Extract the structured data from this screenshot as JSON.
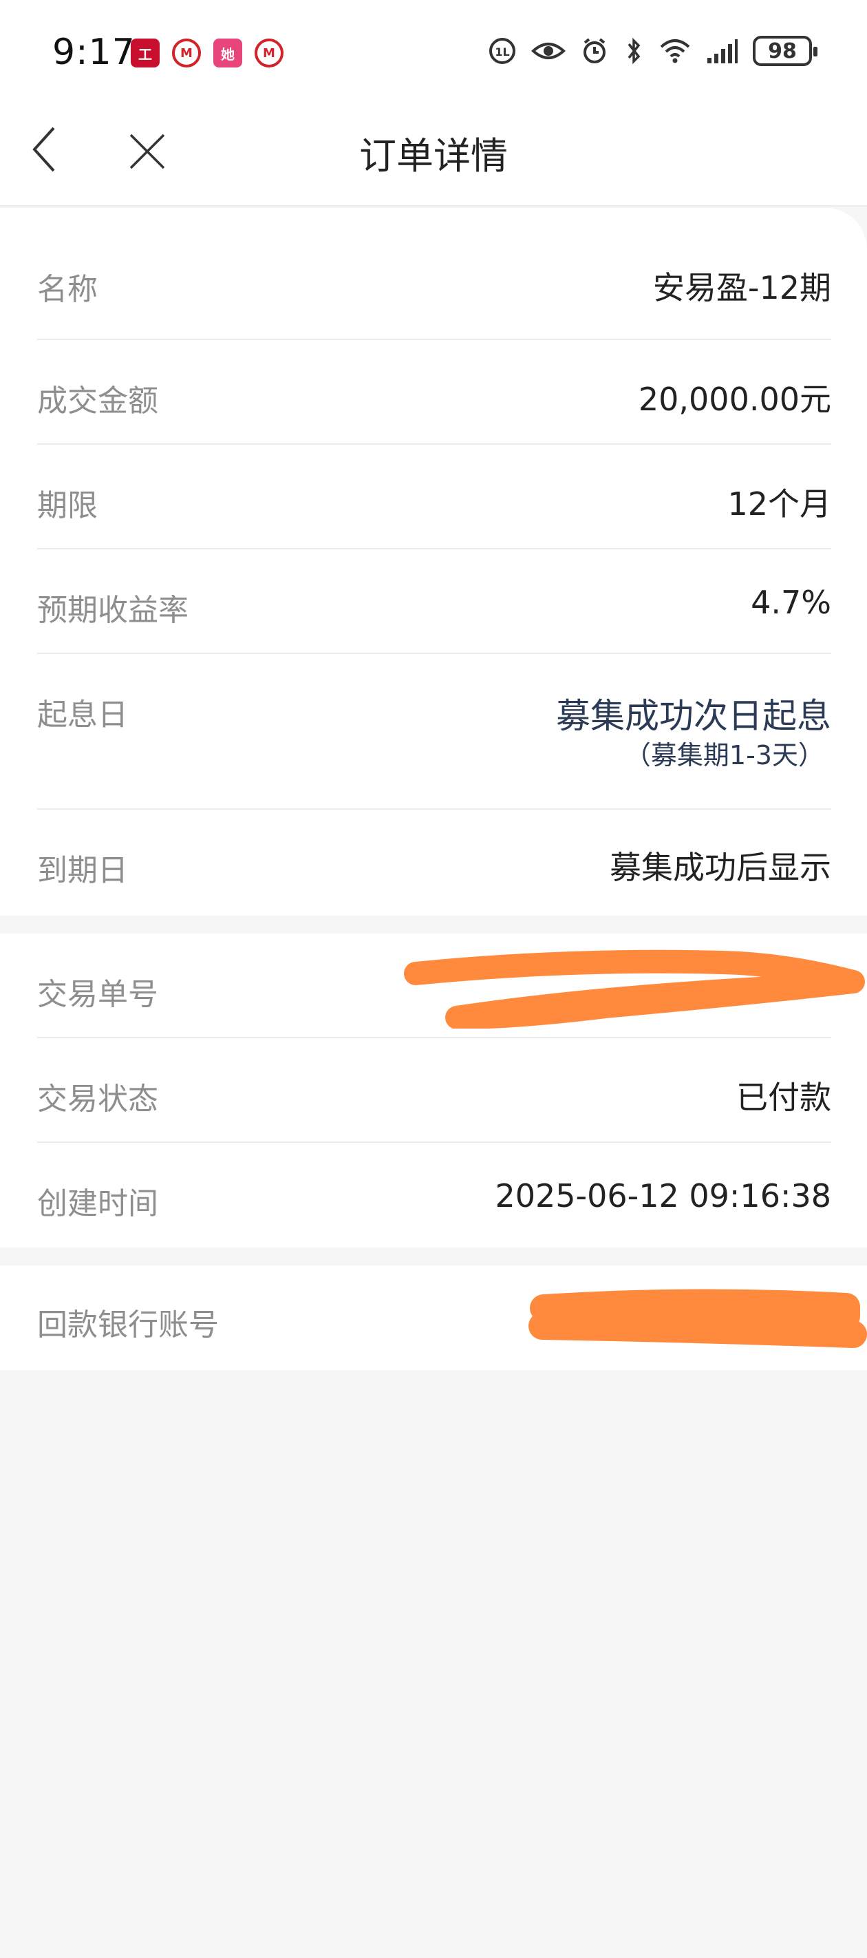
{
  "status_bar": {
    "time": "9:17",
    "battery": "98",
    "app_icons": [
      "bank-app-icon",
      "cmb-app-icon",
      "she-app-icon",
      "cmb-app-icon"
    ],
    "system_icons": [
      "hd-icon",
      "eye-icon",
      "alarm-icon",
      "bluetooth-icon",
      "wifi-icon",
      "signal-icon"
    ]
  },
  "nav": {
    "title": "订单详情",
    "back_icon": "chevron-left-icon",
    "close_icon": "close-icon"
  },
  "detail": {
    "name_label": "名称",
    "name_value": "安易盈-12期",
    "amount_label": "成交金额",
    "amount_value": "20,000.00元",
    "term_label": "期限",
    "term_value": "12个月",
    "yield_label": "预期收益率",
    "yield_value": "4.7%",
    "start_label": "起息日",
    "start_value": "募集成功次日起息",
    "start_note": "（募集期1-3天）",
    "maturity_label": "到期日",
    "maturity_value": "募集成功后显示"
  },
  "transaction": {
    "order_no_label": "交易单号",
    "status_label": "交易状态",
    "status_value": "已付款",
    "created_label": "创建时间",
    "created_value": "2025-06-12 09:16:38"
  },
  "refund": {
    "account_label": "回款银行账号"
  },
  "colors": {
    "redaction": "#ff8a3d",
    "value_navy": "#2b3a55",
    "label_gray": "#8e8e8e",
    "background": "#f6f6f6"
  }
}
